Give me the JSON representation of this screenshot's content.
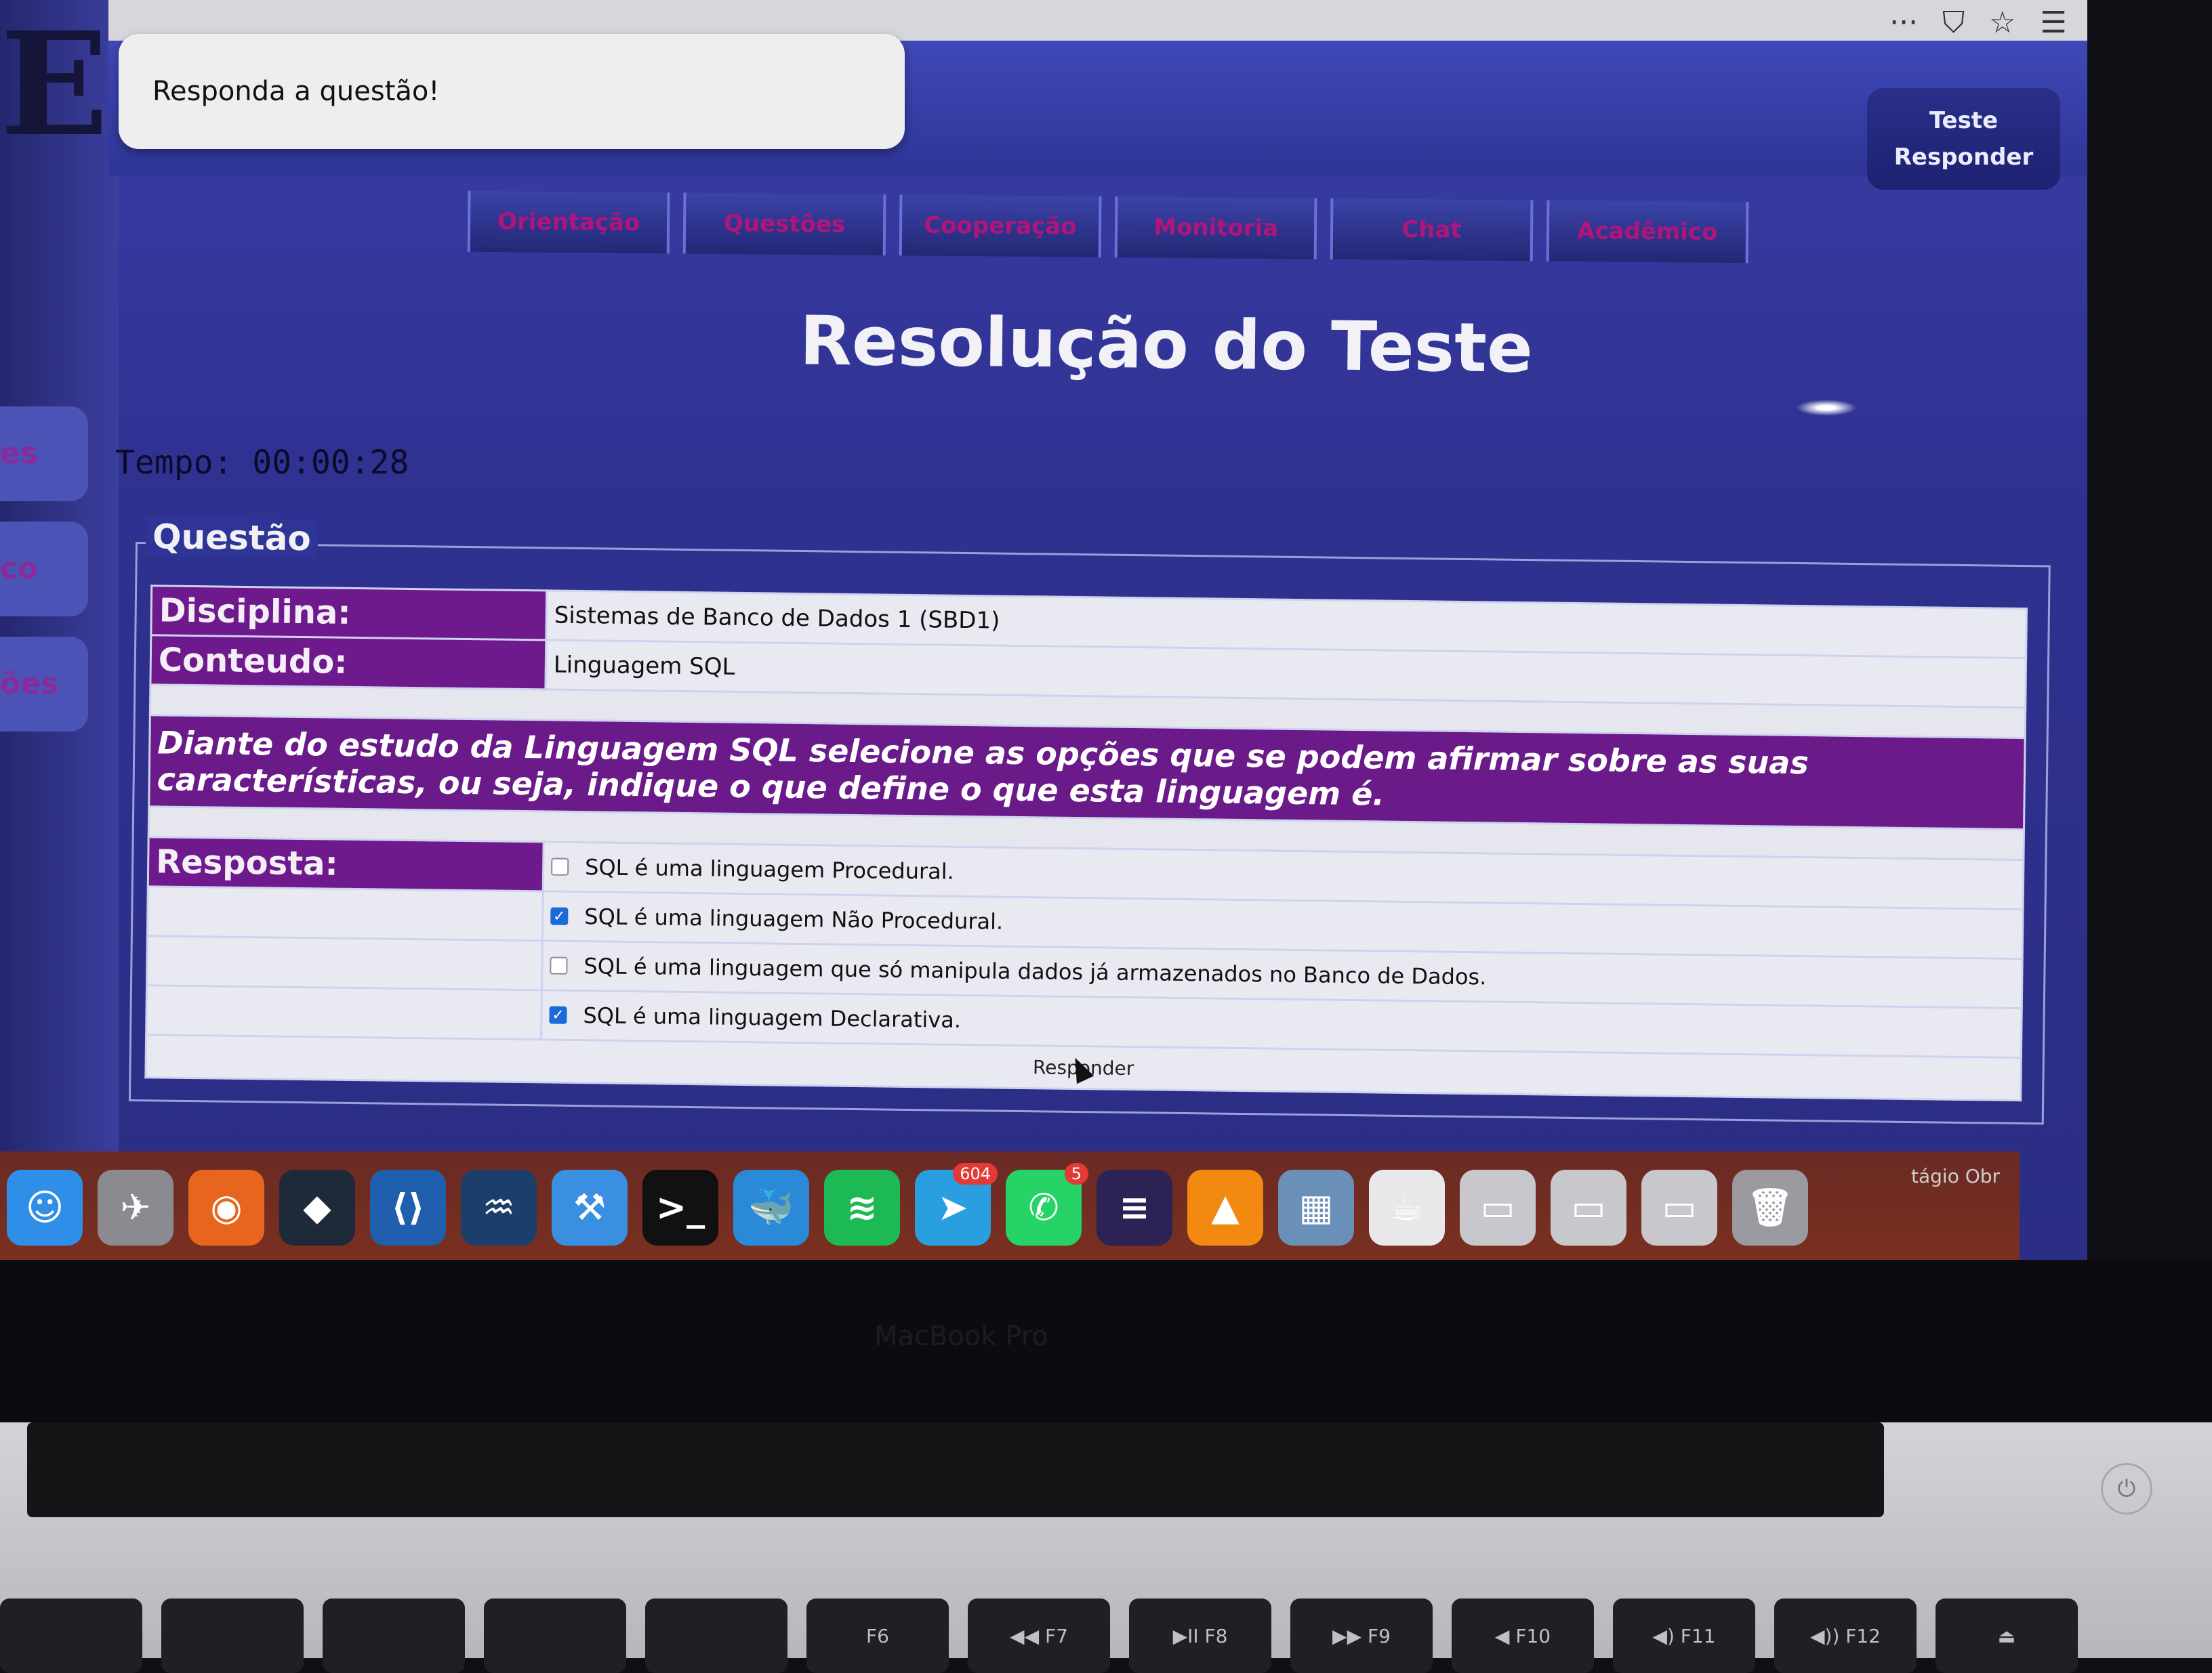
{
  "browser": {
    "menu_icons": [
      "···",
      "⛉",
      "☆",
      "☰"
    ]
  },
  "header": {
    "message": "Responda a questão!",
    "actions": [
      "Teste",
      "Responder"
    ]
  },
  "nav": {
    "items": [
      "Orientação",
      "Questões",
      "Cooperação",
      "Monitoria",
      "Chat",
      "Acadêmico"
    ]
  },
  "left_panel": {
    "big_letter": "E",
    "tabs": [
      "es",
      "co",
      "ões"
    ]
  },
  "page": {
    "title": "Resolução do Teste",
    "timer": "Tempo: 00:00:28"
  },
  "question": {
    "legend": "Questão",
    "disciplina_label": "Disciplina:",
    "disciplina_value": "Sistemas de Banco de Dados 1 (SBD1)",
    "conteudo_label": "Conteudo:",
    "conteudo_value": "Linguagem SQL",
    "statement": "Diante do estudo da Linguagem SQL selecione as opções que se podem afirmar sobre as suas características, ou seja, indique o que define o que esta linguagem é.",
    "resposta_label": "Resposta:",
    "options": [
      {
        "text": "SQL é uma linguagem Procedural.",
        "checked": false
      },
      {
        "text": "SQL é uma linguagem Não Procedural.",
        "checked": true
      },
      {
        "text": "SQL é uma linguagem que só manipula dados já armazenados no Banco de Dados.",
        "checked": false
      },
      {
        "text": "SQL é uma linguagem Declarativa.",
        "checked": true
      }
    ],
    "submit_label": "Responder"
  },
  "dock": {
    "apps": [
      {
        "name": "finder-icon",
        "glyph": "☺",
        "color": "#2f8fe8"
      },
      {
        "name": "launchpad-icon",
        "glyph": "✈",
        "color": "#8a8a90"
      },
      {
        "name": "firefox-icon",
        "glyph": "◉",
        "color": "#e8651d"
      },
      {
        "name": "sourcetree-icon",
        "glyph": "◆",
        "color": "#1e2a3a"
      },
      {
        "name": "vscode-icon",
        "glyph": "⟨⟩",
        "color": "#1f5fae"
      },
      {
        "name": "mysql-workbench-icon",
        "glyph": "♒",
        "color": "#1b3f6a"
      },
      {
        "name": "xcode-icon",
        "glyph": "⚒",
        "color": "#3a8fe0"
      },
      {
        "name": "terminal-icon",
        "glyph": ">_",
        "color": "#111111"
      },
      {
        "name": "docker-icon",
        "glyph": "🐳",
        "color": "#2a8ad8"
      },
      {
        "name": "spotify-icon",
        "glyph": "≋",
        "color": "#1db954"
      },
      {
        "name": "telegram-icon",
        "glyph": "➤",
        "color": "#2a9fe0",
        "badge": "604"
      },
      {
        "name": "whatsapp-icon",
        "glyph": "✆",
        "color": "#25d366",
        "badge": "5"
      },
      {
        "name": "eclipse-icon",
        "glyph": "≡",
        "color": "#2c2255"
      },
      {
        "name": "vlc-icon",
        "glyph": "▲",
        "color": "#f28a12"
      },
      {
        "name": "preview-icon",
        "glyph": "▦",
        "color": "#6a8fb8"
      },
      {
        "name": "java-icon",
        "glyph": "☕",
        "color": "#e8e8ea"
      },
      {
        "name": "window-thumb-1-icon",
        "glyph": "▭",
        "color": "#c8c8cc"
      },
      {
        "name": "window-thumb-2-icon",
        "glyph": "▭",
        "color": "#c8c8cc"
      },
      {
        "name": "window-thumb-3-icon",
        "glyph": "▭",
        "color": "#c8c8cc"
      },
      {
        "name": "trash-icon",
        "glyph": "🗑",
        "color": "#9a9aa0"
      }
    ],
    "trailing_label": "tágio Obr"
  },
  "hardware": {
    "brand_label": "MacBook Pro",
    "keys": [
      "",
      "",
      "",
      "",
      "",
      "F6",
      "◀◀ F7",
      "▶II F8",
      "▶▶ F9",
      "◀ F10",
      "◀) F11",
      "◀)) F12",
      "⏏"
    ]
  }
}
